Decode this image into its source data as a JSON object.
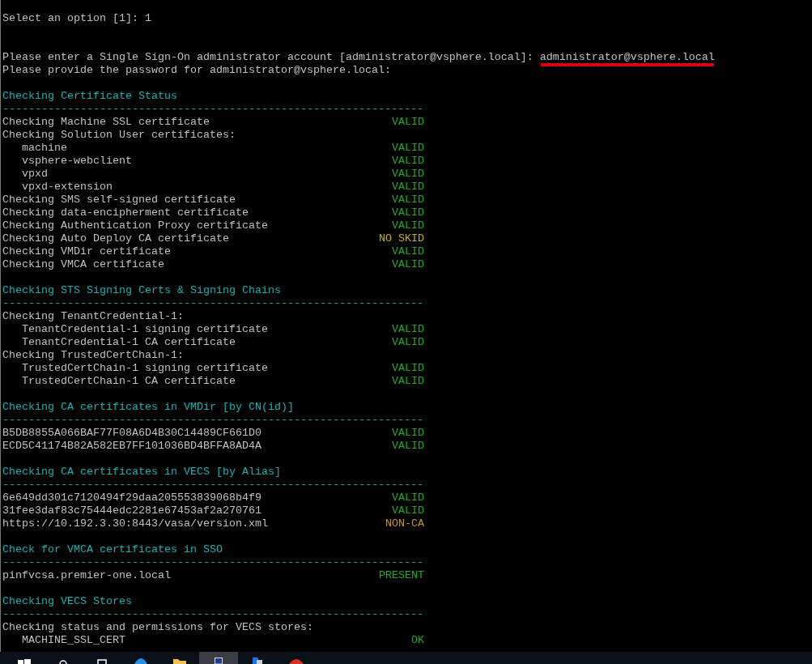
{
  "terminal": {
    "option_prompt": "Select an option [1]: 1",
    "account_prompt": {
      "text": "Please enter a Single Sign-On administrator account [administrator@vsphere.local]:",
      "answer": "administrator@vsphere.local",
      "underlined": true
    },
    "password_prompt": "Please provide the password for administrator@vsphere.local:",
    "sections": [
      {
        "heading": "Checking Certificate Status",
        "rule": "-----------------------------------------------------------------",
        "items": [
          {
            "label": "Checking Machine SSL certificate",
            "status": "VALID",
            "color": "#1cad1c"
          },
          {
            "label": "Checking Solution User certificates:",
            "children": [
              {
                "label": "machine",
                "status": "VALID",
                "color": "#1cad1c"
              },
              {
                "label": "vsphere-webclient",
                "status": "VALID",
                "color": "#1cad1c"
              },
              {
                "label": "vpxd",
                "status": "VALID",
                "color": "#1cad1c"
              },
              {
                "label": "vpxd-extension",
                "status": "VALID",
                "color": "#1cad1c"
              }
            ]
          },
          {
            "label": "Checking SMS self-signed certificate",
            "status": "VALID",
            "color": "#1cad1c"
          },
          {
            "label": "Checking data-encipherment certificate",
            "status": "VALID",
            "color": "#1cad1c"
          },
          {
            "label": "Checking Authentication Proxy certificate",
            "status": "VALID",
            "color": "#1cad1c"
          },
          {
            "label": "Checking Auto Deploy CA certificate",
            "status": "NO SKID",
            "color": "#c4b400"
          },
          {
            "label": "Checking VMDir certificate",
            "status": "VALID",
            "color": "#1cad1c"
          },
          {
            "label": "Checking VMCA certificate",
            "status": "VALID",
            "color": "#1cad1c"
          }
        ]
      },
      {
        "heading": "Checking STS Signing Certs & Signing Chains",
        "rule": "-----------------------------------------------------------------",
        "items": [
          {
            "label": "Checking TenantCredential-1:",
            "children": [
              {
                "label": "TenantCredential-1 signing certificate",
                "status": "VALID",
                "color": "#1cad1c"
              },
              {
                "label": "TenantCredential-1 CA certificate",
                "status": "VALID",
                "color": "#1cad1c"
              }
            ]
          },
          {
            "label": "Checking TrustedCertChain-1:",
            "children": [
              {
                "label": "TrustedCertChain-1 signing certificate",
                "status": "VALID",
                "color": "#1cad1c"
              },
              {
                "label": "TrustedCertChain-1 CA certificate",
                "status": "VALID",
                "color": "#1cad1c"
              }
            ]
          }
        ]
      },
      {
        "heading": "Checking CA certificates in VMDir [by CN(id)]",
        "rule": "-----------------------------------------------------------------",
        "items": [
          {
            "label": "B5DB8855A066BAF77F08A6D4B30C14489CF661D0",
            "status": "VALID",
            "color": "#1cad1c"
          },
          {
            "label": "ECD5C41174B82A582EB7FF101036BD4BFFA8AD4A",
            "status": "VALID",
            "color": "#1cad1c"
          }
        ]
      },
      {
        "heading": "Checking CA certificates in VECS [by Alias]",
        "rule": "-----------------------------------------------------------------",
        "items": [
          {
            "label": "6e649dd301c7120494f29daa205553839068b4f9",
            "status": "VALID",
            "color": "#1cad1c"
          },
          {
            "label": "31fee3daf83c75444edc2281e67453af2a270761",
            "status": "VALID",
            "color": "#1cad1c"
          },
          {
            "label": "https://10.192.3.30:8443/vasa/version.xml",
            "status": "NON-CA",
            "color": "#c8961e"
          }
        ]
      },
      {
        "heading": "Check for VMCA certificates in SSO",
        "rule": "-----------------------------------------------------------------",
        "items": [
          {
            "label": "pinfvcsa.premier-one.local",
            "status": "PRESENT",
            "color": "#1cad1c"
          }
        ]
      },
      {
        "heading": "Checking VECS Stores",
        "rule": "-----------------------------------------------------------------",
        "items": [
          {
            "label": "Checking status and permissions for VECS stores:",
            "children": [
              {
                "label": "MACHINE_SSL_CERT",
                "status": "OK",
                "color": "#1cad1c"
              }
            ]
          }
        ]
      }
    ]
  },
  "taskbar": {
    "buttons": [
      {
        "selected": false
      },
      {
        "selected": false
      },
      {
        "selected": false
      },
      {
        "selected": false
      },
      {
        "selected": false
      },
      {
        "selected": true
      },
      {
        "selected": false
      },
      {
        "selected": false
      }
    ]
  }
}
